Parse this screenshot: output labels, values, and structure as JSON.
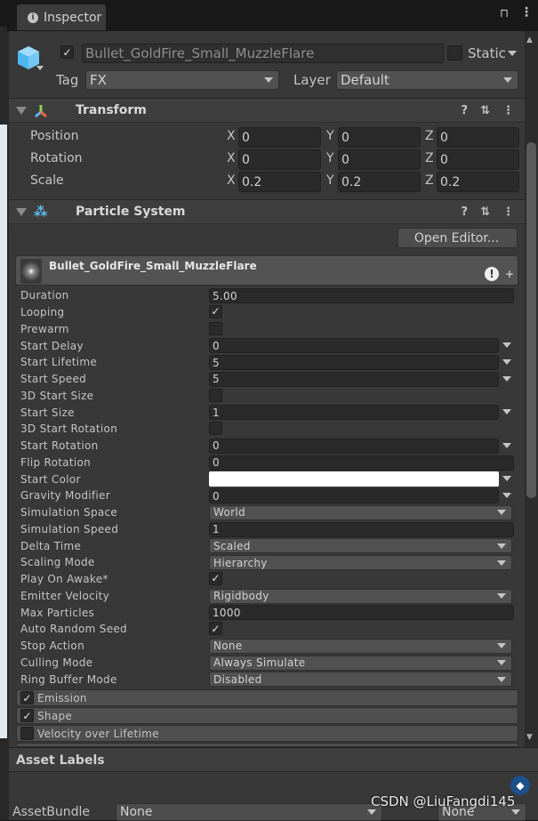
{
  "tab": {
    "title": "Inspector"
  },
  "object": {
    "active": true,
    "name": "Bullet_GoldFire_Small_MuzzleFlare",
    "static_label": "Static",
    "static": false,
    "tag_label": "Tag",
    "tag": "FX",
    "layer_label": "Layer",
    "layer": "Default"
  },
  "transform": {
    "title": "Transform",
    "rows": [
      {
        "label": "Position",
        "x": "0",
        "y": "0",
        "z": "0"
      },
      {
        "label": "Rotation",
        "x": "0",
        "y": "0",
        "z": "0"
      },
      {
        "label": "Scale",
        "x": "0.2",
        "y": "0.2",
        "z": "0.2"
      }
    ],
    "axes": [
      "X",
      "Y",
      "Z"
    ]
  },
  "particle": {
    "title": "Particle System",
    "open_editor": "Open Editor...",
    "system_name": "Bullet_GoldFire_Small_MuzzleFlare",
    "rows": [
      {
        "label": "Duration",
        "type": "field",
        "value": "5.00"
      },
      {
        "label": "Looping",
        "type": "check",
        "value": true
      },
      {
        "label": "Prewarm",
        "type": "check",
        "value": false
      },
      {
        "label": "Start Delay",
        "type": "fieldarrow",
        "value": "0"
      },
      {
        "label": "Start Lifetime",
        "type": "fieldarrow",
        "value": "5"
      },
      {
        "label": "Start Speed",
        "type": "fieldarrow",
        "value": "5"
      },
      {
        "label": "3D Start Size",
        "type": "check",
        "value": false
      },
      {
        "label": "Start Size",
        "type": "fieldarrow",
        "value": "1"
      },
      {
        "label": "3D Start Rotation",
        "type": "check",
        "value": false
      },
      {
        "label": "Start Rotation",
        "type": "fieldarrow",
        "value": "0"
      },
      {
        "label": "Flip Rotation",
        "type": "field",
        "value": "0"
      },
      {
        "label": "Start Color",
        "type": "color",
        "value": "#ffffff"
      },
      {
        "label": "Gravity Modifier",
        "type": "fieldarrow",
        "value": "0"
      },
      {
        "label": "Simulation Space",
        "type": "drop",
        "value": "World"
      },
      {
        "label": "Simulation Speed",
        "type": "field",
        "value": "1"
      },
      {
        "label": "Delta Time",
        "type": "drop",
        "value": "Scaled"
      },
      {
        "label": "Scaling Mode",
        "type": "drop",
        "value": "Hierarchy"
      },
      {
        "label": "Play On Awake*",
        "type": "check",
        "value": true
      },
      {
        "label": "Emitter Velocity",
        "type": "drop",
        "value": "Rigidbody"
      },
      {
        "label": "Max Particles",
        "type": "field",
        "value": "1000"
      },
      {
        "label": "Auto Random Seed",
        "type": "check",
        "value": true
      },
      {
        "label": "Stop Action",
        "type": "drop",
        "value": "None"
      },
      {
        "label": "Culling Mode",
        "type": "drop",
        "value": "Always Simulate"
      },
      {
        "label": "Ring Buffer Mode",
        "type": "drop",
        "value": "Disabled"
      }
    ],
    "modules": [
      {
        "label": "Emission",
        "enabled": true
      },
      {
        "label": "Shape",
        "enabled": true
      },
      {
        "label": "Velocity over Lifetime",
        "enabled": false
      }
    ]
  },
  "asset_labels": {
    "title": "Asset Labels",
    "bundle_label": "AssetBundle",
    "bundle": "None",
    "variant": "None"
  },
  "watermark": "CSDN @LiuFangdi145"
}
